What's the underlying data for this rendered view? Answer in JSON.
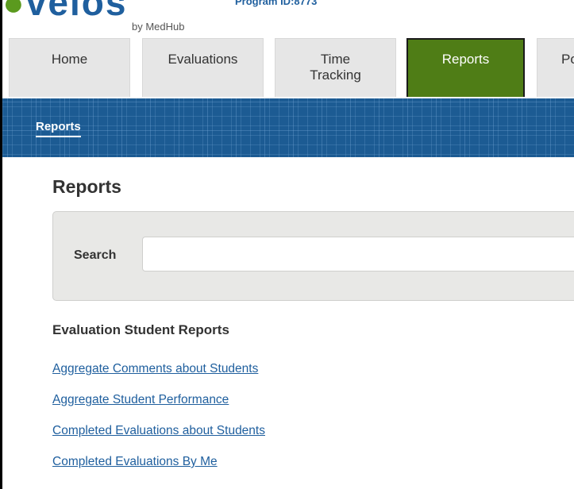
{
  "header": {
    "logo_text_a": "",
    "logo_text_b": "velos",
    "byline": "by MedHub",
    "program_id": "Program ID:8773"
  },
  "tabs": [
    {
      "label": "Home",
      "active": false
    },
    {
      "label": "Evaluations",
      "active": false
    },
    {
      "label": "Time Tracking",
      "active": false
    },
    {
      "label": "Reports",
      "active": true
    },
    {
      "label": "Po",
      "active": false
    }
  ],
  "banner": {
    "breadcrumb": "Reports"
  },
  "main": {
    "title": "Reports",
    "search": {
      "label": "Search",
      "value": "",
      "placeholder": ""
    },
    "section_heading": "Evaluation Student Reports",
    "reports": [
      "Aggregate Comments about Students",
      "Aggregate Student Performance",
      "Completed Evaluations about Students",
      "Completed Evaluations By Me"
    ]
  },
  "colors": {
    "brand_blue": "#1f5f9e",
    "active_tab_green": "#4f7d16",
    "banner_blue": "#1c5b93",
    "link_blue": "#1f5f9e"
  }
}
